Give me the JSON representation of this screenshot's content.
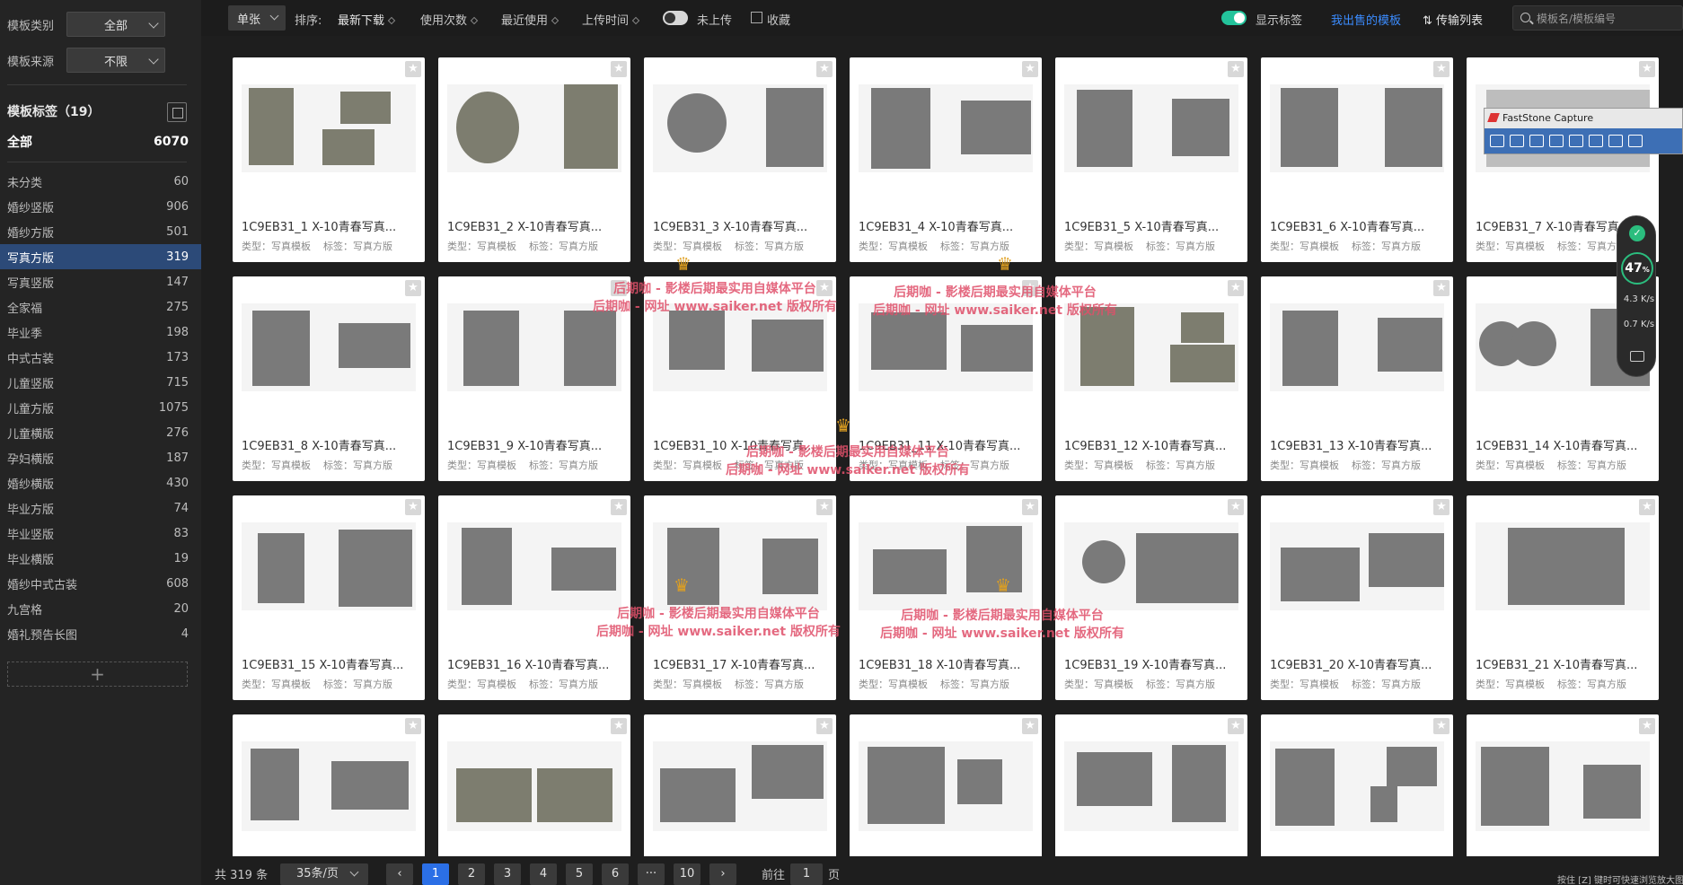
{
  "sidebar": {
    "filters": [
      {
        "label": "模板类别",
        "value": "全部"
      },
      {
        "label": "模板来源",
        "value": "不限"
      }
    ],
    "tags_title": "模板标签（19）",
    "all_label": "全部",
    "all_count": "6070",
    "tags": [
      {
        "label": "未分类",
        "count": "60"
      },
      {
        "label": "婚纱竖版",
        "count": "906"
      },
      {
        "label": "婚纱方版",
        "count": "501"
      },
      {
        "label": "写真方版",
        "count": "319"
      },
      {
        "label": "写真竖版",
        "count": "147"
      },
      {
        "label": "全家福",
        "count": "275"
      },
      {
        "label": "毕业季",
        "count": "198"
      },
      {
        "label": "中式古装",
        "count": "173"
      },
      {
        "label": "儿童竖版",
        "count": "715"
      },
      {
        "label": "儿童方版",
        "count": "1075"
      },
      {
        "label": "儿童横版",
        "count": "276"
      },
      {
        "label": "孕妇横版",
        "count": "187"
      },
      {
        "label": "婚纱横版",
        "count": "430"
      },
      {
        "label": "毕业方版",
        "count": "74"
      },
      {
        "label": "毕业竖版",
        "count": "83"
      },
      {
        "label": "毕业横版",
        "count": "19"
      },
      {
        "label": "婚纱中式古装",
        "count": "608"
      },
      {
        "label": "九宫格",
        "count": "20"
      },
      {
        "label": "婚礼预告长图",
        "count": "4"
      }
    ],
    "add_symbol": "+"
  },
  "toolbar": {
    "mode": "单张",
    "sort_label": "排序:",
    "sort_options": [
      "最新下载",
      "使用次数",
      "最近使用",
      "上传时间"
    ],
    "not_uploaded": "未上传",
    "favorite": "收藏",
    "show_tags": "显示标签",
    "my_sold": "我出售的模板",
    "transfer": "⇅ 传输列表",
    "search_placeholder": "模板名/模板编号"
  },
  "cards": [
    {
      "name": "1C9EB31_1  X-10青春写真..."
    },
    {
      "name": "1C9EB31_2  X-10青春写真..."
    },
    {
      "name": "1C9EB31_3  X-10青春写真..."
    },
    {
      "name": "1C9EB31_4  X-10青春写真..."
    },
    {
      "name": "1C9EB31_5  X-10青春写真..."
    },
    {
      "name": "1C9EB31_6  X-10青春写真..."
    },
    {
      "name": "1C9EB31_7  X-10青春写真..."
    },
    {
      "name": "1C9EB31_8  X-10青春写真..."
    },
    {
      "name": "1C9EB31_9  X-10青春写真..."
    },
    {
      "name": "1C9EB31_10  X-10青春写真..."
    },
    {
      "name": "1C9EB31_11  X-10青春写真..."
    },
    {
      "name": "1C9EB31_12  X-10青春写真..."
    },
    {
      "name": "1C9EB31_13  X-10青春写真..."
    },
    {
      "name": "1C9EB31_14  X-10青春写真..."
    },
    {
      "name": "1C9EB31_15  X-10青春写真..."
    },
    {
      "name": "1C9EB31_16  X-10青春写真..."
    },
    {
      "name": "1C9EB31_17  X-10青春写真..."
    },
    {
      "name": "1C9EB31_18  X-10青春写真..."
    },
    {
      "name": "1C9EB31_19  X-10青春写真..."
    },
    {
      "name": "1C9EB31_20  X-10青春写真..."
    },
    {
      "name": "1C9EB31_21  X-10青春写真..."
    }
  ],
  "card_meta": {
    "type": "类型：写真模板",
    "tag": "标签：写真方版"
  },
  "watermark": {
    "line1": "后期咖 - 影楼后期最实用自媒体平台",
    "line2": "后期咖 - 网址 www.saiker.net 版权所有"
  },
  "faststone": {
    "title": "FastStone Capture"
  },
  "netmon": {
    "percent": "47",
    "up": "4.3 K/s",
    "down": "0.7 K/s"
  },
  "pager": {
    "total": "共 319 条",
    "page_size": "35条/页",
    "pages": [
      "1",
      "2",
      "3",
      "4",
      "5",
      "6",
      "···",
      "10"
    ],
    "goto": "前往",
    "goto_value": "1",
    "page_unit": "页"
  },
  "hint": "按住 [Z] 键时可快速浏览放大图"
}
